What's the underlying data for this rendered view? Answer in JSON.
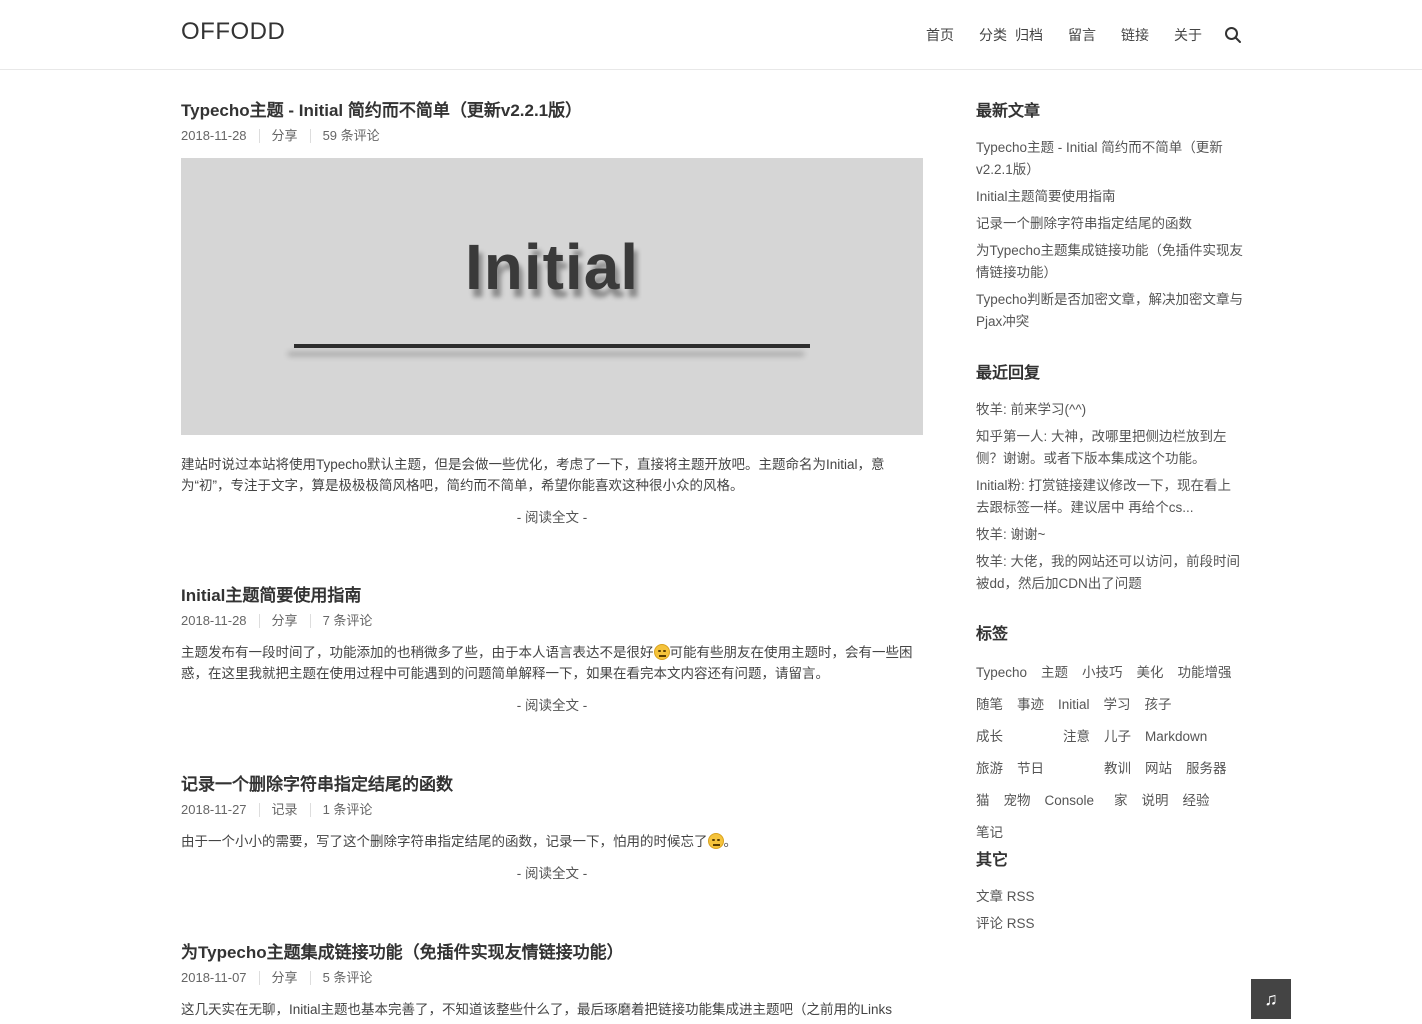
{
  "site": {
    "logo": "OFFODD"
  },
  "nav": {
    "items": [
      "首页",
      "分类",
      "归档",
      "留言",
      "链接",
      "关于"
    ],
    "search_icon": "search-icon"
  },
  "posts": [
    {
      "title": "Typecho主题 - Initial 简约而不简单（更新v2.2.1版）",
      "date": "2018-11-28",
      "category": "分享",
      "comments": "59 条评论",
      "thumb_word": "Initial",
      "excerpt": "建站时说过本站将使用Typecho默认主题，但是会做一些优化，考虑了一下，直接将主题开放吧。主题命名为Initial，意为“初”，专注于文字，算是极极极简风格吧，简约而不简单，希望你能喜欢这种很小众的风格。",
      "readmore": "- 阅读全文 -"
    },
    {
      "title": "Initial主题简要使用指南",
      "date": "2018-11-28",
      "category": "分享",
      "comments": "7 条评论",
      "excerpt_a": "主题发布有一段时间了，功能添加的也稍微多了些，由于本人语言表达不是很好",
      "excerpt_b": "可能有些朋友在使用主题时，会有一些困惑，在这里我就把主题在使用过程中可能遇到的问题简单解释一下，如果在看完本文内容还有问题，请留言。",
      "readmore": "- 阅读全文 -"
    },
    {
      "title": "记录一个删除字符串指定结尾的函数",
      "date": "2018-11-27",
      "category": "记录",
      "comments": "1 条评论",
      "excerpt_a": "由于一个小小的需要，写了这个删除字符串指定结尾的函数，记录一下，怕用的时候忘了",
      "excerpt_b": "。",
      "readmore": "- 阅读全文 -"
    },
    {
      "title": "为Typecho主题集成链接功能（免插件实现友情链接功能）",
      "date": "2018-11-07",
      "category": "分享",
      "comments": "5 条评论",
      "excerpt": "这几天实在无聊，Initial主题也基本完善了，不知道该整些什么了，最后琢磨着把链接功能集成进主题吧（之前用的Links"
    }
  ],
  "sidebar": {
    "recent_posts": {
      "title": "最新文章",
      "items": [
        "Typecho主题 - Initial 简约而不简单（更新v2.2.1版）",
        "Initial主题简要使用指南",
        "记录一个删除字符串指定结尾的函数",
        "为Typecho主题集成链接功能（免插件实现友情链接功能）",
        "Typecho判断是否加密文章，解决加密文章与Pjax冲突"
      ]
    },
    "recent_comments": {
      "title": "最近回复",
      "items": [
        "牧羊: 前来学习(^^)",
        "知乎第一人: 大神，改哪里把侧边栏放到左侧？谢谢。或者下版本集成这个功能。",
        "Initial粉: 打赏链接建议修改一下，现在看上去跟标签一样。建议居中 再给个cs...",
        "牧羊: 谢谢~",
        "牧羊: 大佬，我的网站还可以访问，前段时间被dd，然后加CDN出了问题"
      ]
    },
    "tags": {
      "title": "标签",
      "items": [
        "Typecho",
        "主题",
        "小技巧",
        "美化",
        "功能增强",
        "随笔",
        "事迹",
        "Initial",
        "学习",
        "孩子",
        "成长",
        "注意",
        "儿子",
        "Markdown",
        "旅游",
        "节日",
        "教训",
        "网站",
        "服务器",
        "猫",
        "宠物",
        "Console",
        "家",
        "说明",
        "经验",
        "笔记"
      ]
    },
    "other": {
      "title": "其它",
      "items": [
        "文章 RSS",
        "评论 RSS"
      ]
    }
  },
  "music_button": {
    "icon": "♫"
  }
}
